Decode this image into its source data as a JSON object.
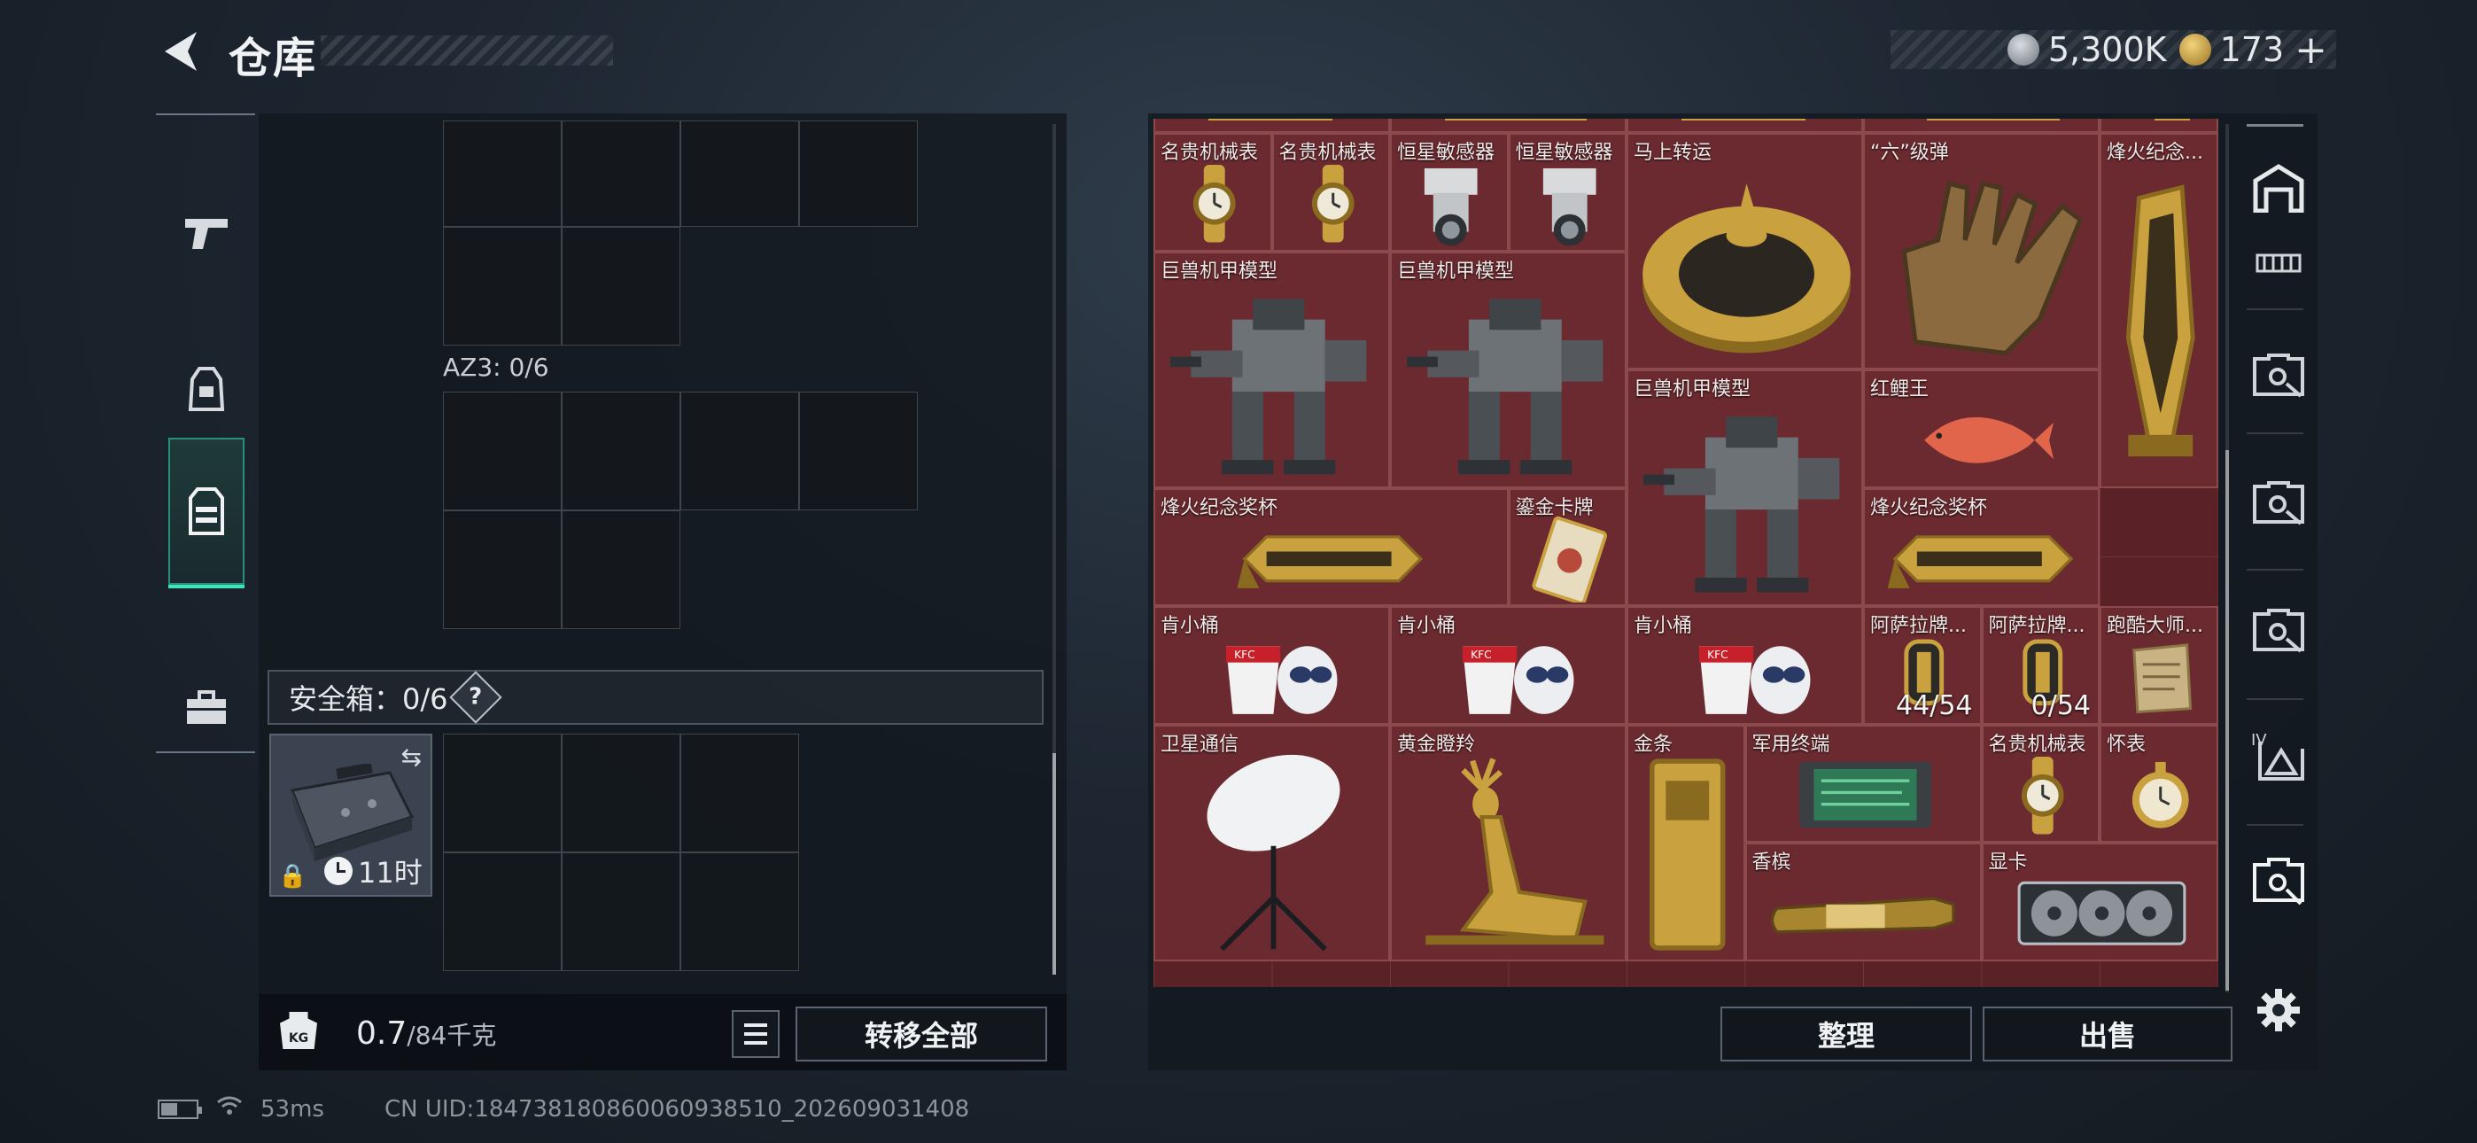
{
  "header": {
    "title": "仓库",
    "currency": [
      {
        "icon": "silver-coin-icon",
        "value": "5,300K"
      },
      {
        "icon": "gold-coin-icon",
        "value": "173"
      }
    ],
    "plus": "+"
  },
  "tabs": [
    {
      "icon": "pistol-icon",
      "active": false
    },
    {
      "icon": "backpack-icon",
      "active": false
    },
    {
      "icon": "vest-icon",
      "active": true
    },
    {
      "icon": "briefcase-icon",
      "active": false
    }
  ],
  "left_panel": {
    "az3_label": "AZ3: 0/6",
    "safebox_label": "安全箱：0/6",
    "help": "?",
    "case_timer": "11时",
    "weight_value": "0.7",
    "weight_capacity": "/84千克",
    "weight_badge": "KG",
    "transfer_all": "转移全部"
  },
  "storage_items": [
    {
      "name": "名贵机械表",
      "kind": "watch"
    },
    {
      "name": "名贵机械表",
      "kind": "watch"
    },
    {
      "name": "恒星敏感器",
      "kind": "sensor"
    },
    {
      "name": "恒星敏感器",
      "kind": "sensor"
    },
    {
      "name": "马上转运",
      "kind": "disc"
    },
    {
      "name": "“六”级弹",
      "kind": "hand"
    },
    {
      "name": "烽火纪念...",
      "kind": "trophy-v"
    },
    {
      "name": "巨兽机甲模型",
      "kind": "mech"
    },
    {
      "name": "巨兽机甲模型",
      "kind": "mech"
    },
    {
      "name": "巨兽机甲模型",
      "kind": "mech"
    },
    {
      "name": "红鲤王",
      "kind": "fish"
    },
    {
      "name": "烽火纪念奖杯",
      "kind": "trophy-h"
    },
    {
      "name": "鎏金卡牌",
      "kind": "card"
    },
    {
      "name": "烽火纪念奖杯",
      "kind": "trophy-h"
    },
    {
      "name": "肯小桶",
      "kind": "bucket"
    },
    {
      "name": "肯小桶",
      "kind": "bucket"
    },
    {
      "name": "肯小桶",
      "kind": "bucket"
    },
    {
      "name": "阿萨拉牌...",
      "kind": "token",
      "count": "44/54"
    },
    {
      "name": "阿萨拉牌...",
      "kind": "token",
      "count": "0/54"
    },
    {
      "name": "跑酷大师...",
      "kind": "paper"
    },
    {
      "name": "卫星通信",
      "kind": "dish"
    },
    {
      "name": "黄金瞪羚",
      "kind": "deer"
    },
    {
      "name": "金条",
      "kind": "bar"
    },
    {
      "name": "军用终端",
      "kind": "terminal"
    },
    {
      "name": "名贵机械表",
      "kind": "watch"
    },
    {
      "name": "怀表",
      "kind": "pocketwatch"
    },
    {
      "name": "香槟",
      "kind": "bottle"
    },
    {
      "name": "显卡",
      "kind": "gpu"
    }
  ],
  "right_panel": {
    "sort": "整理",
    "sell": "出售"
  },
  "filters": [
    {
      "icon": "storage-icon"
    },
    {
      "icon": "filter-ammo-icon"
    },
    {
      "icon": "filter-key-icon"
    },
    {
      "icon": "filter-key-icon"
    },
    {
      "icon": "filter-key-icon"
    },
    {
      "icon": "filter-key-iv-icon"
    },
    {
      "icon": "filter-key-icon"
    },
    {
      "icon": "settings-icon"
    }
  ],
  "status": {
    "ping": "53ms",
    "uid": "CN UID:18473818086006093851​0_202609031408"
  }
}
